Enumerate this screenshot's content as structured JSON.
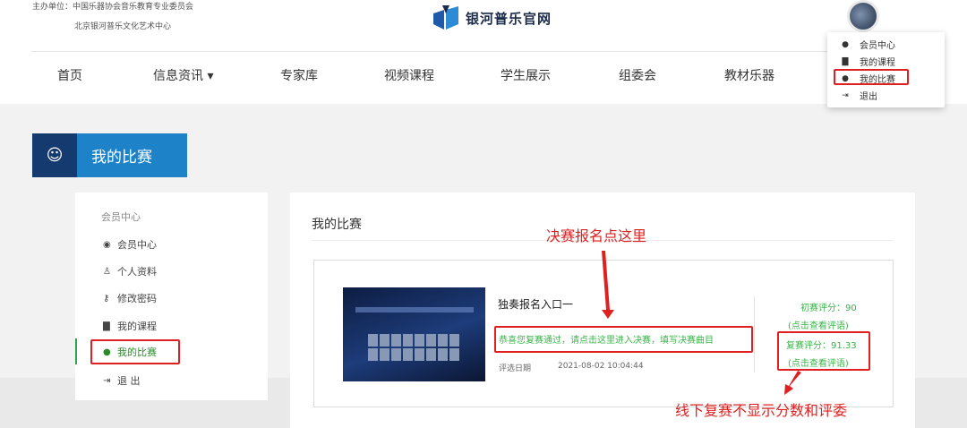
{
  "header": {
    "host_line1": "主办单位：中国乐器协会音乐教育专业委员会",
    "host_line2": "北京银河普乐文化艺术中心",
    "logo_text": "银河普乐官网"
  },
  "nav": {
    "items": [
      "首页",
      "信息资讯 ▾",
      "专家库",
      "视频课程",
      "学生展示",
      "组委会",
      "教材乐器"
    ]
  },
  "user_menu": {
    "items": [
      {
        "icon": "user-icon",
        "label": "会员中心"
      },
      {
        "icon": "briefcase-icon",
        "label": "我的课程"
      },
      {
        "icon": "comments-icon",
        "label": "我的比赛"
      },
      {
        "icon": "sign-out-icon",
        "label": "退出"
      }
    ]
  },
  "banner": {
    "title": "我的比赛",
    "icon": "user-outline-icon"
  },
  "sidebar": {
    "heading": "会员中心",
    "items": [
      {
        "icon": "user-circle-icon",
        "label": "会员中心"
      },
      {
        "icon": "user-outline-icon",
        "label": "个人资料"
      },
      {
        "icon": "key-icon",
        "label": "修改密码"
      },
      {
        "icon": "briefcase-icon",
        "label": "我的课程"
      },
      {
        "icon": "comments-icon",
        "label": "我的比赛"
      },
      {
        "icon": "sign-out-icon",
        "label": "退 出"
      }
    ]
  },
  "main": {
    "title": "我的比赛",
    "entry": {
      "title": "独奏报名入口一",
      "message": "恭喜您复赛通过，请点击这里进入决赛，填写决赛曲目",
      "date_label": "评选日期",
      "date_value": "2021-08-02 10:04:44",
      "prelim_score": "初赛评分：90",
      "prelim_link": "(点击查看评语)",
      "semi_score": "复赛评分：91.33",
      "semi_link": "(点击查看评语)"
    }
  },
  "annotations": {
    "final_signup": "决赛报名点这里",
    "offline_note": "线下复赛不显示分数和评委"
  },
  "colors": {
    "accent_blue": "#1e82c8",
    "dark_blue": "#153a70",
    "green": "#3cb44b",
    "annotation_red": "#e02020"
  }
}
